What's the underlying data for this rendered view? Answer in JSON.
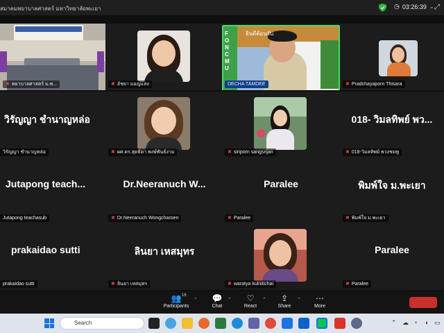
{
  "topbar": {
    "title": "สมาคมพยาบาลศาสตร์ มหาวิทยาลัยพะเยา",
    "timer": "03:26:39",
    "timer_chev": "⌄",
    "icon": "⤢"
  },
  "tiles": [
    {
      "id": "t1",
      "name": "พยาบาลศาสตร์ ม.พ..."
    },
    {
      "id": "t2",
      "name": "อัชยา มอญแสง"
    },
    {
      "id": "t3",
      "name": "DECHA TAMDEE"
    },
    {
      "id": "t4",
      "name": "Pradchayaporn Thisara"
    },
    {
      "id": "t5",
      "name": "วิรัญญา ชำนาญหล่อ",
      "big": "วิรัญญา ชำนาญหล่อ"
    },
    {
      "id": "t6",
      "name": "ผศ.ดร.สุดธิดา พงษ์พันธ์งาม"
    },
    {
      "id": "t7",
      "name": "siriporn sangsrijan"
    },
    {
      "id": "t8",
      "name": "018-วิมลทิพย์ พวงชมพู",
      "big": "018- วิมลทิพย์ พว..."
    },
    {
      "id": "t9",
      "name": "Jutapong teachasub",
      "big": "Jutapong teach..."
    },
    {
      "id": "t10",
      "name": "Dr.Neeranuch Wongcharoen",
      "big": "Dr.Neeranuch W..."
    },
    {
      "id": "t11",
      "name": "Paralee",
      "big": "Paralee"
    },
    {
      "id": "t12",
      "name": "พิมพ์ใจ ม.พะเยา",
      "big": "พิมพ์ใจ ม.พะเยา"
    },
    {
      "id": "t13",
      "name": "prakaidao sutti",
      "big": "prakaidao sutti"
    },
    {
      "id": "t14",
      "name": "ลินยา เหสมุทร",
      "big": "ลินยา เหสมุทร"
    },
    {
      "id": "t15",
      "name": "waratya kulnitichai"
    },
    {
      "id": "t16",
      "name": "Paralee",
      "big": "Paralee"
    }
  ],
  "banner": {
    "side": "FONCMU",
    "top": "ยินดีต้อนรับ"
  },
  "toolbar": {
    "participants_label": "Participants",
    "participants_count": "16",
    "chat_label": "Chat",
    "react_label": "React",
    "share_label": "Share",
    "more_label": "More"
  },
  "taskbar": {
    "search_placeholder": "Search"
  },
  "colors": {
    "active_speaker": "#4cd964",
    "mic_muted": "#e84545",
    "end": "#c9302c"
  }
}
